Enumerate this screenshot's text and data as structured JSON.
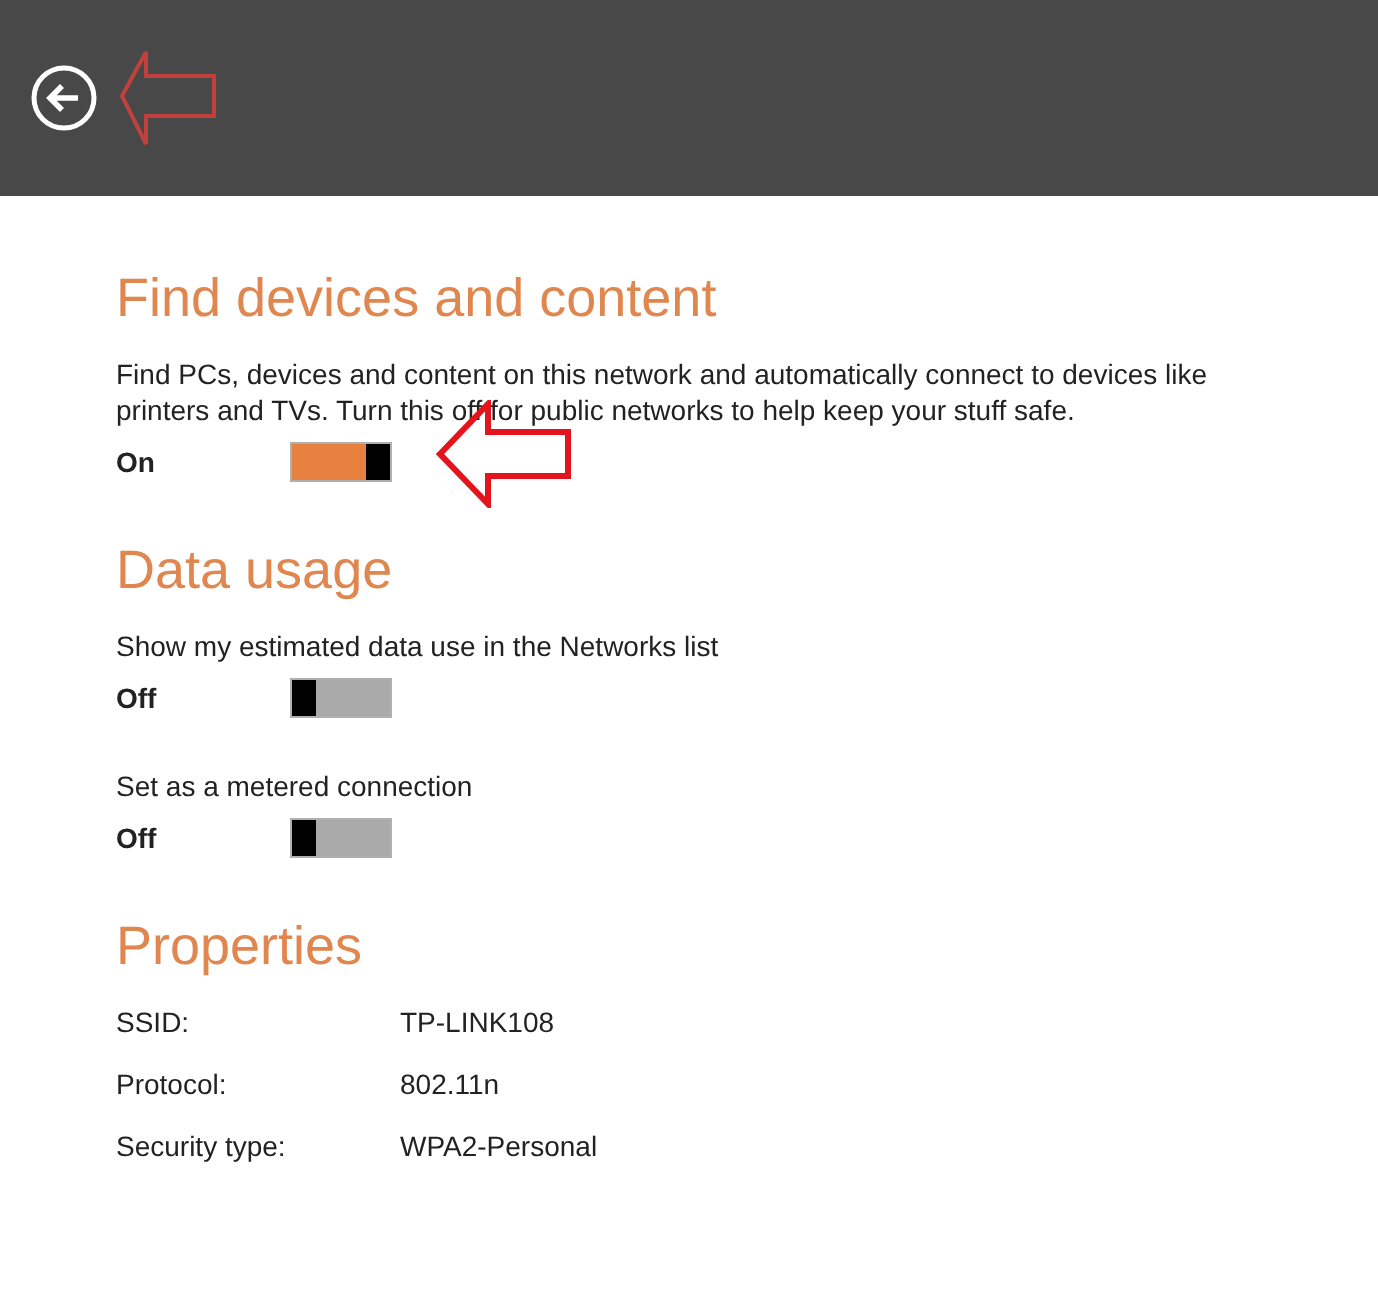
{
  "sections": [
    {
      "kind": "toggles",
      "title": "Find devices and content",
      "settings": [
        {
          "description": "Find PCs, devices and content on this network and automatically connect to devices like printers and TVs. Turn this off for public networks to help keep your stuff safe.",
          "state_label": "On",
          "on": true
        }
      ]
    },
    {
      "kind": "toggles",
      "title": "Data usage",
      "settings": [
        {
          "description": "Show my estimated data use in the Networks list",
          "state_label": "Off",
          "on": false
        },
        {
          "description": "Set as a metered connection",
          "state_label": "Off",
          "on": false
        }
      ]
    },
    {
      "kind": "properties",
      "title": "Properties",
      "rows": [
        {
          "label": "SSID:",
          "value": "TP-LINK108"
        },
        {
          "label": "Protocol:",
          "value": "802.11n"
        },
        {
          "label": "Security type:",
          "value": "WPA2-Personal"
        }
      ]
    }
  ]
}
